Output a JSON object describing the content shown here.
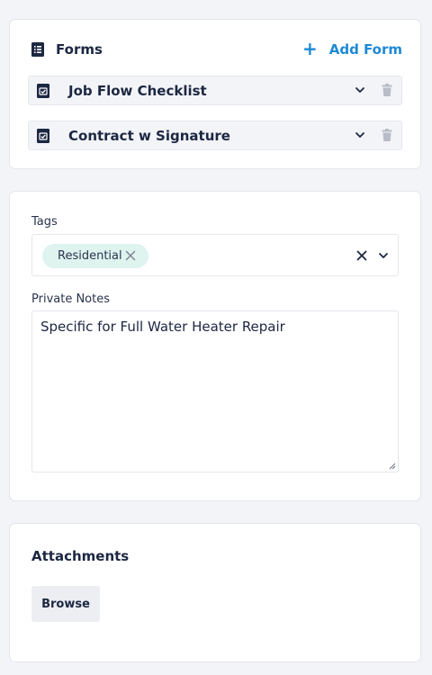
{
  "forms": {
    "title": "Forms",
    "add_label": "Add Form",
    "items": [
      {
        "name": "Job Flow Checklist"
      },
      {
        "name": "Contract w Signature"
      }
    ]
  },
  "tags": {
    "label": "Tags",
    "selected": [
      "Residential"
    ]
  },
  "notes": {
    "label": "Private Notes",
    "value": "Specific for Full Water Heater Repair"
  },
  "attachments": {
    "title": "Attachments",
    "browse_label": "Browse"
  },
  "colors": {
    "accent": "#1d89d6",
    "tag_chip": "#dff3ef",
    "text": "#1c2742"
  }
}
